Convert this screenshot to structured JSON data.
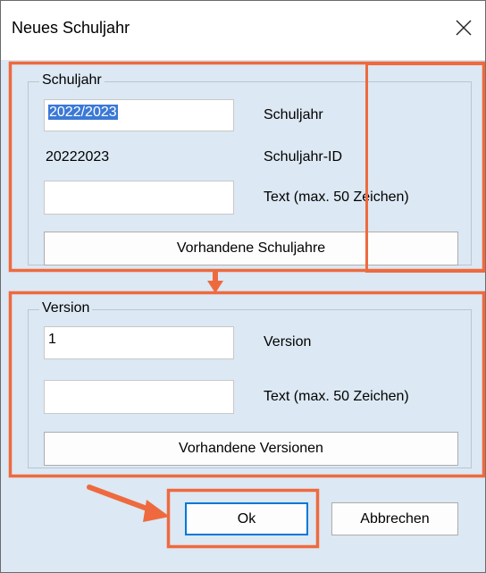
{
  "window": {
    "title": "Neues Schuljahr",
    "close_icon": "close-icon"
  },
  "schuljahr_group": {
    "legend": "Schuljahr",
    "schuljahr_value": "2022/2023",
    "schuljahr_label": "Schuljahr",
    "id_value": "20222023",
    "id_label": "Schuljahr-ID",
    "text_value": "",
    "text_label": "Text (max. 50 Zeichen)",
    "existing_button": "Vorhandene Schuljahre"
  },
  "version_group": {
    "legend": "Version",
    "version_value": "1",
    "version_label": "Version",
    "text_value": "",
    "text_label": "Text (max. 50 Zeichen)",
    "existing_button": "Vorhandene Versionen"
  },
  "footer": {
    "ok_label": "Ok",
    "cancel_label": "Abbrechen"
  },
  "annotation": {
    "highlight_color": "#ee6a3e"
  }
}
